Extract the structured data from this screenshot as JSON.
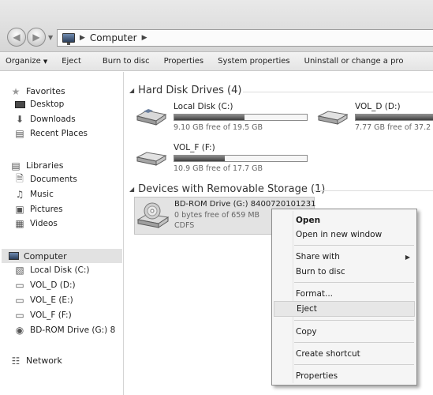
{
  "address": {
    "back_icon": "arrow-left-icon",
    "forward_icon": "arrow-right-icon",
    "breadcrumb": [
      "Computer"
    ]
  },
  "toolbar": {
    "organize": "Organize",
    "eject": "Eject",
    "burn": "Burn to disc",
    "properties": "Properties",
    "system_properties": "System properties",
    "uninstall": "Uninstall or change a pro"
  },
  "nav": {
    "favorites": "Favorites",
    "desktop": "Desktop",
    "downloads": "Downloads",
    "recent": "Recent Places",
    "libraries": "Libraries",
    "documents": "Documents",
    "music": "Music",
    "pictures": "Pictures",
    "videos": "Videos",
    "computer": "Computer",
    "local_c": "Local Disk (C:)",
    "vol_d": "VOL_D (D:)",
    "vol_e": "VOL_E (E:)",
    "vol_f": "VOL_F (F:)",
    "bdrom": "BD-ROM Drive (G:) 8",
    "network": "Network"
  },
  "hard_disks": {
    "title": "Hard Disk Drives (4)",
    "drives": [
      {
        "name": "Local Disk (C:)",
        "free": "9.10 GB free of 19.5 GB",
        "used_fraction": 0.53
      },
      {
        "name": "VOL_D (D:)",
        "free": "7.77 GB free of 37.2 G",
        "used_fraction": 0.79
      },
      {
        "name": "VOL_F (F:)",
        "free": "10.9 GB free of 17.7 GB",
        "used_fraction": 0.38
      }
    ]
  },
  "removable": {
    "title": "Devices with Removable Storage (1)",
    "name": "BD-ROM Drive (G:) 8400720101231",
    "free": "0 bytes free of 659 MB",
    "fs": "CDFS"
  },
  "context_menu": {
    "open": "Open",
    "open_new_window": "Open in new window",
    "share_with": "Share with",
    "burn_to_disc": "Burn to disc",
    "format": "Format...",
    "eject": "Eject",
    "copy": "Copy",
    "create_shortcut": "Create shortcut",
    "properties": "Properties"
  }
}
